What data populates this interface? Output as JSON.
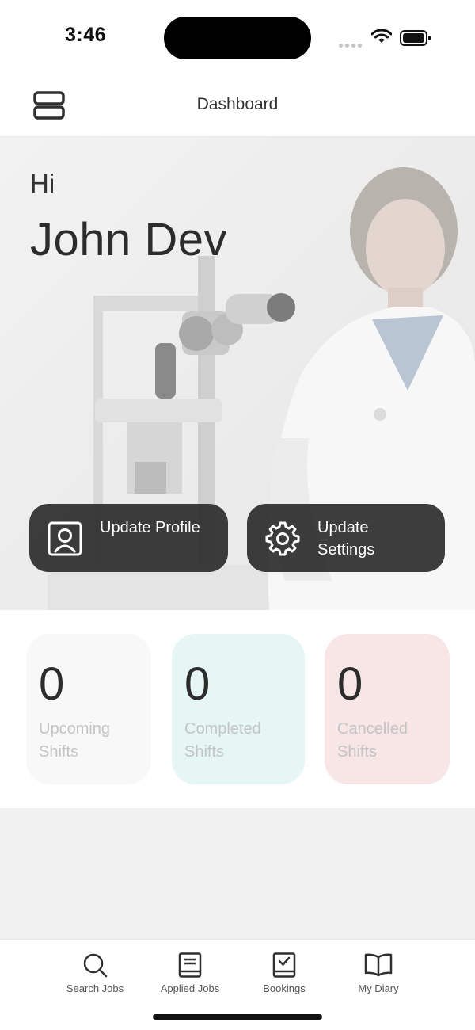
{
  "status_bar": {
    "time": "3:46"
  },
  "header": {
    "title": "Dashboard",
    "menu_icon": "menu-icon"
  },
  "hero": {
    "greeting": "Hi",
    "user_name": "John Dev",
    "actions": [
      {
        "label": "Update Profile",
        "icon": "profile-icon"
      },
      {
        "label": "Update Settings",
        "icon": "gear-icon"
      }
    ]
  },
  "stats": [
    {
      "value": "0",
      "label": "Upcoming Shifts",
      "color": "#f8f8f8"
    },
    {
      "value": "0",
      "label": "Completed Shifts",
      "color": "#e6f6f5"
    },
    {
      "value": "0",
      "label": "Cancelled Shifts",
      "color": "#f8e5e5"
    }
  ],
  "tabs": [
    {
      "label": "Search Jobs",
      "icon": "search-icon"
    },
    {
      "label": "Applied Jobs",
      "icon": "book-icon"
    },
    {
      "label": "Bookings",
      "icon": "bookings-check-icon"
    },
    {
      "label": "My Diary",
      "icon": "open-book-icon"
    }
  ]
}
